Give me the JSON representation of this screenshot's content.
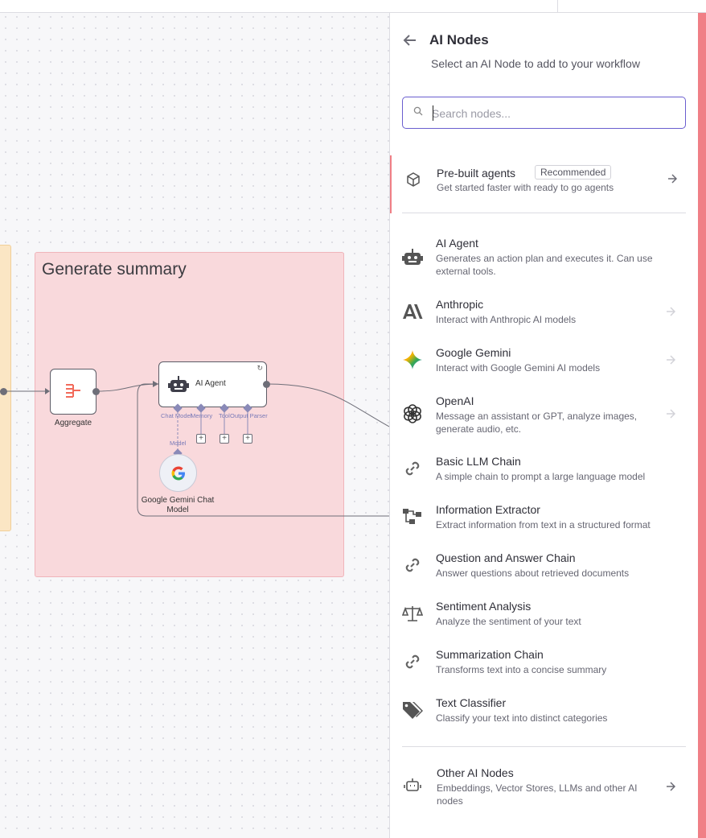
{
  "canvas": {
    "group_title": "Generate summary",
    "nodes": {
      "aggregate": "Aggregate",
      "ai_agent": "AI Agent",
      "gemini": "Google Gemini Chat Model"
    },
    "sub_ports": [
      "Chat Model",
      "Memory",
      "Tool",
      "Output Parser"
    ],
    "model_label": "Model"
  },
  "panel": {
    "title": "AI Nodes",
    "subtitle": "Select an AI Node to add to your workflow",
    "search": {
      "placeholder": "Search nodes...",
      "value": ""
    },
    "prebuilt": {
      "title": "Pre-built agents",
      "badge": "Recommended",
      "desc": "Get started faster with ready to go agents"
    },
    "items": [
      {
        "icon": "robot-icon",
        "title": "AI Agent",
        "desc": "Generates an action plan and executes it. Can use external tools."
      },
      {
        "icon": "anthropic-icon",
        "title": "Anthropic",
        "desc": "Interact with Anthropic AI models"
      },
      {
        "icon": "gemini-icon",
        "title": "Google Gemini",
        "desc": "Interact with Google Gemini AI models"
      },
      {
        "icon": "openai-icon",
        "title": "OpenAI",
        "desc": "Message an assistant or GPT, analyze images, generate audio, etc."
      },
      {
        "icon": "link-icon",
        "title": "Basic LLM Chain",
        "desc": "A simple chain to prompt a large language model"
      },
      {
        "icon": "extractor-icon",
        "title": "Information Extractor",
        "desc": "Extract information from text in a structured format"
      },
      {
        "icon": "link-icon",
        "title": "Question and Answer Chain",
        "desc": "Answer questions about retrieved documents"
      },
      {
        "icon": "balance-scale-icon",
        "title": "Sentiment Analysis",
        "desc": "Analyze the sentiment of your text"
      },
      {
        "icon": "link-icon",
        "title": "Summarization Chain",
        "desc": "Transforms text into a concise summary"
      },
      {
        "icon": "tags-icon",
        "title": "Text Classifier",
        "desc": "Classify your text into distinct categories"
      }
    ],
    "other": {
      "title": "Other AI Nodes",
      "desc": "Embeddings, Vector Stores, LLMs and other AI nodes"
    }
  },
  "colors": {
    "accent": "#6a5ecf",
    "edge": "#f07f86",
    "sticky_red": "#f9d9dc",
    "sticky_yellow": "#fbe6c4"
  }
}
